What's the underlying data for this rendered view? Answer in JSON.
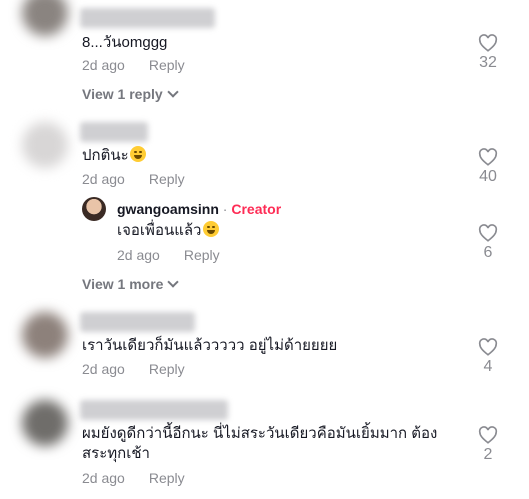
{
  "comments": [
    {
      "text": "8...วันomggg",
      "time": "2d ago",
      "reply": "Reply",
      "likes": "32",
      "view": "View 1 reply"
    },
    {
      "text": "ปกตินะ",
      "emoji": "rofl-emoji",
      "time": "2d ago",
      "reply": "Reply",
      "likes": "40",
      "view": "View 1 more"
    },
    {
      "text": "เราวันเดียวก็มันแล้ววววว อยู่ไม่ด้ายยยย",
      "time": "2d ago",
      "reply": "Reply",
      "likes": "4"
    },
    {
      "text": "ผมยังดูดีกว่านี้อีกนะ นี่ไม่สระวันเดียวคือมันเยิ้มมาก ต้องสระทุกเช้า",
      "time": "2d ago",
      "reply": "Reply",
      "likes": "2"
    }
  ],
  "creator_reply": {
    "username": "gwangoamsinn",
    "separator": "·",
    "badge": "Creator",
    "text": "เจอเพื่อนแล้ว",
    "emoji": "grin-emoji",
    "time": "2d ago",
    "reply": "Reply",
    "likes": "6"
  },
  "icons": {
    "like": "heart-outline-icon",
    "expand": "chevron-down-icon"
  },
  "colors": {
    "creator_badge": "#fe2c55",
    "meta": "#8a8b91",
    "text": "#161823"
  }
}
